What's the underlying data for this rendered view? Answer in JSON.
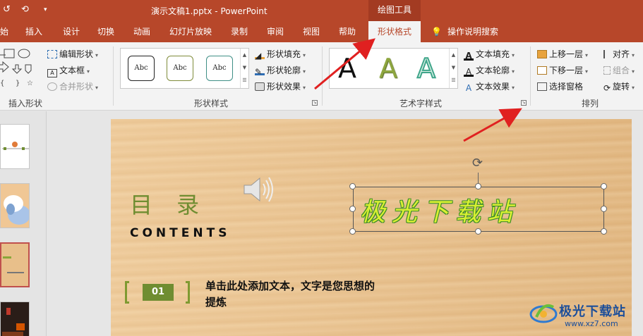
{
  "titlebar": {
    "document_title": "演示文稿1.pptx  -  PowerPoint",
    "context_tab": "绘图工具"
  },
  "tabs": [
    "始",
    "插入",
    "设计",
    "切换",
    "动画",
    "幻灯片放映",
    "录制",
    "审阅",
    "视图",
    "帮助",
    "形状格式"
  ],
  "active_tab": "形状格式",
  "search_tab": "操作说明搜索",
  "ribbon": {
    "insert_shapes": {
      "label": "插入形状",
      "edit_shape": "编辑形状",
      "text_box": "文本框",
      "merge_shapes": "合并形状"
    },
    "shape_styles": {
      "label": "形状样式",
      "swatches": [
        "Abc",
        "Abc",
        "Abc"
      ],
      "swatch_colors": [
        "#222222",
        "#7f8c3a",
        "#3f8f86"
      ],
      "fill": "形状填充",
      "outline": "形状轮廓",
      "effects": "形状效果"
    },
    "wordart_styles": {
      "label": "艺术字样式",
      "letters": [
        "A",
        "A",
        "A"
      ],
      "letter_colors": [
        "#111111",
        "#8ea63f",
        "#3fa58a"
      ],
      "text_fill": "文本填充",
      "text_outline": "文本轮廓",
      "text_effects": "文本效果"
    },
    "arrange": {
      "label": "排列",
      "bring_forward": "上移一层",
      "send_backward": "下移一层",
      "selection_pane": "选择窗格",
      "align": "对齐",
      "group": "组合",
      "rotate": "旋转"
    }
  },
  "slide": {
    "title_cn": "目 录",
    "title_en": "CONTENTS",
    "wordart_text": "极光下载站",
    "item_number": "01",
    "item_text": "单击此处添加文本，文字是您思想的提炼"
  },
  "watermark": {
    "name": "极光下载站",
    "url": "www.xz7.com"
  },
  "colors": {
    "accent": "#b7472a",
    "slide_green": "#6f8d31",
    "arrow_red": "#e02020"
  }
}
